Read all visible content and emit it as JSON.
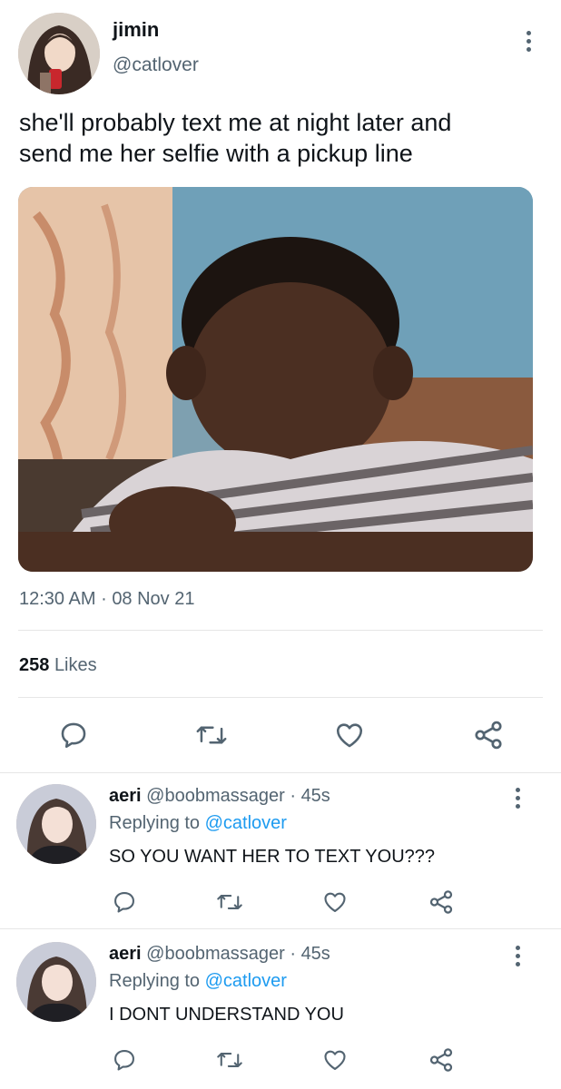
{
  "tweet": {
    "display_name": "jimin",
    "handle": "@catlover",
    "text_line1": "she'll probably text me at night later and",
    "text_line2": "send me her selfie with a pickup line",
    "time": "12:30 AM",
    "date_sep": "·",
    "date": "08 Nov 21",
    "likes_count": "258",
    "likes_label": "Likes"
  },
  "replies": [
    {
      "name": "aeri",
      "handle": "@boobmassager",
      "time_sep": "·",
      "time": "45s",
      "replying_prefix": "Replying to",
      "replying_to": "@catlover",
      "text": "SO YOU WANT HER TO TEXT YOU???"
    },
    {
      "name": "aeri",
      "handle": "@boobmassager",
      "time_sep": "·",
      "time": "45s",
      "replying_prefix": "Replying to",
      "replying_to": "@catlover",
      "text": "I DONT UNDERSTAND YOU"
    }
  ],
  "icons": {
    "reply": "comment-icon",
    "retweet": "retweet-icon",
    "like": "heart-icon",
    "share": "share-icon",
    "more": "more-vertical-icon"
  },
  "colors": {
    "text": "#0f1419",
    "muted": "#536471",
    "link": "#1d9bf0",
    "divider": "#e6e6e6"
  }
}
